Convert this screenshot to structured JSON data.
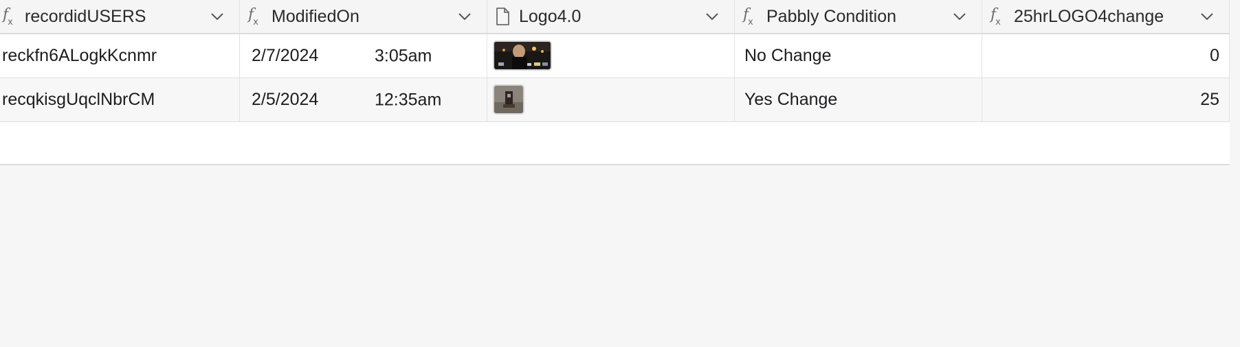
{
  "table": {
    "columns": [
      {
        "label": "recordidUSERS",
        "icon": "formula-icon"
      },
      {
        "label": "ModifiedOn",
        "icon": "formula-icon"
      },
      {
        "label": "Logo4.0",
        "icon": "file-icon"
      },
      {
        "label": "Pabbly Condition",
        "icon": "formula-icon"
      },
      {
        "label": "25hrLOGO4change",
        "icon": "formula-icon"
      }
    ],
    "rows": [
      {
        "recordid": "reckfn6ALogkKcnmr",
        "date": "2/7/2024",
        "time": "3:05am",
        "attachment": "dark-screenshot-thumbnail",
        "condition": "No Change",
        "change": "0"
      },
      {
        "recordid": "recqkisgUqclNbrCM",
        "date": "2/5/2024",
        "time": "12:35am",
        "attachment": "photo-thumbnail",
        "condition": "Yes Change",
        "change": "25"
      }
    ]
  },
  "colors": {
    "background": "#f6f6f6",
    "header_bg": "#f5f5f5",
    "row_bg": "#ffffff",
    "row_alt_bg": "#f7f7f7",
    "border": "#dcdcdc"
  }
}
